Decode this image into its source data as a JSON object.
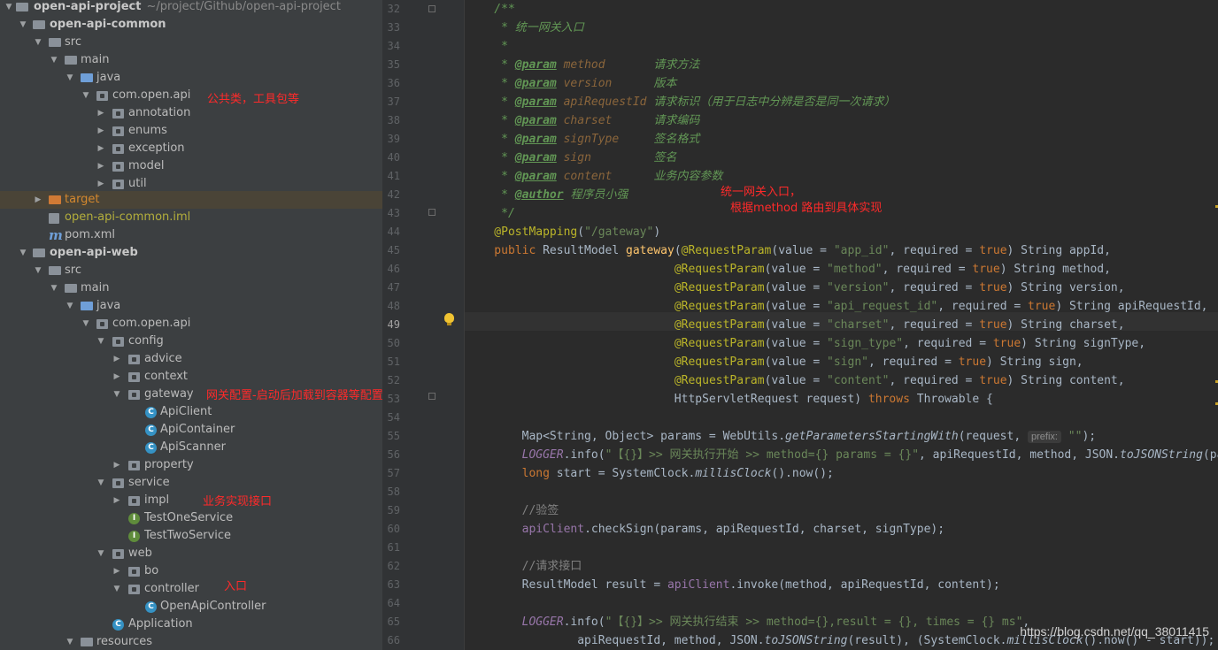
{
  "project_tree": {
    "project": {
      "name": "open-api-project",
      "path": "~/project/Github/open-api-project"
    },
    "rows": [
      {
        "label": "open-api-project"
      },
      {
        "label": "open-api-common"
      },
      {
        "label": "src"
      },
      {
        "label": "main"
      },
      {
        "label": "java"
      },
      {
        "label": "com.open.api"
      },
      {
        "label": "annotation"
      },
      {
        "label": "enums"
      },
      {
        "label": "exception"
      },
      {
        "label": "model"
      },
      {
        "label": "util"
      },
      {
        "label": "target"
      },
      {
        "label": "open-api-common.iml"
      },
      {
        "label": "pom.xml"
      },
      {
        "label": "open-api-web"
      },
      {
        "label": "src"
      },
      {
        "label": "main"
      },
      {
        "label": "java"
      },
      {
        "label": "com.open.api"
      },
      {
        "label": "config"
      },
      {
        "label": "advice"
      },
      {
        "label": "context"
      },
      {
        "label": "gateway"
      },
      {
        "label": "ApiClient"
      },
      {
        "label": "ApiContainer"
      },
      {
        "label": "ApiScanner"
      },
      {
        "label": "property"
      },
      {
        "label": "service"
      },
      {
        "label": "impl"
      },
      {
        "label": "TestOneService"
      },
      {
        "label": "TestTwoService"
      },
      {
        "label": "web"
      },
      {
        "label": "bo"
      },
      {
        "label": "controller"
      },
      {
        "label": "OpenApiController"
      },
      {
        "label": "Application"
      },
      {
        "label": "resources"
      }
    ],
    "icon_chars": {
      "class": "C",
      "interface": "I",
      "maven": "m"
    }
  },
  "annotations": {
    "common_pkg": "公共类，工具包等",
    "gateway": "网关配置-启动后加载到容器等配置",
    "service": "业务实现接口",
    "controller": "入口",
    "editor_line1": "统一网关入口，",
    "editor_line2": "根据method 路由到具体实现"
  },
  "editor": {
    "current_line": 49,
    "hint": "prefix:",
    "lines": [
      {
        "n": 32,
        "t": "/**"
      },
      {
        "n": 33,
        "t": " * 统一网关入口"
      },
      {
        "n": 34,
        "t": " *"
      },
      {
        "n": 35,
        "t": " * @param method       请求方法"
      },
      {
        "n": 36,
        "t": " * @param version      版本"
      },
      {
        "n": 37,
        "t": " * @param apiRequestId 请求标识（用于日志中分辨是否是同一次请求）"
      },
      {
        "n": 38,
        "t": " * @param charset      请求编码"
      },
      {
        "n": 39,
        "t": " * @param signType     签名格式"
      },
      {
        "n": 40,
        "t": " * @param sign         签名"
      },
      {
        "n": 41,
        "t": " * @param content      业务内容参数"
      },
      {
        "n": 42,
        "t": " * @author 程序员小强"
      },
      {
        "n": 43,
        "t": " */"
      },
      {
        "n": 44,
        "t": "@PostMapping(\"/gateway\")"
      },
      {
        "n": 45,
        "t": "public ResultModel gateway(@RequestParam(value = \"app_id\", required = true) String appId,"
      },
      {
        "n": 46,
        "t": "@RequestParam(value = \"method\", required = true) String method,"
      },
      {
        "n": 47,
        "t": "@RequestParam(value = \"version\", required = true) String version,"
      },
      {
        "n": 48,
        "t": "@RequestParam(value = \"api_request_id\", required = true) String apiRequestId,"
      },
      {
        "n": 49,
        "t": "@RequestParam(value = \"charset\", required = true) String charset,"
      },
      {
        "n": 50,
        "t": "@RequestParam(value = \"sign_type\", required = true) String signType,"
      },
      {
        "n": 51,
        "t": "@RequestParam(value = \"sign\", required = true) String sign,"
      },
      {
        "n": 52,
        "t": "@RequestParam(value = \"content\", required = true) String content,"
      },
      {
        "n": 53,
        "t": "HttpServletRequest request) throws Throwable {"
      },
      {
        "n": 54,
        "t": ""
      },
      {
        "n": 55,
        "t": "Map<String, Object> params = WebUtils.getParametersStartingWith(request, \"\");"
      },
      {
        "n": 56,
        "t": "LOGGER.info(\"【{}】>> 网关执行开始 >> method={} params = {}\", apiRequestId, method, JSON.toJSONString(para"
      },
      {
        "n": 57,
        "t": "long start = SystemClock.millisClock().now();"
      },
      {
        "n": 58,
        "t": ""
      },
      {
        "n": 59,
        "t": "//验签"
      },
      {
        "n": 60,
        "t": "apiClient.checkSign(params, apiRequestId, charset, signType);"
      },
      {
        "n": 61,
        "t": ""
      },
      {
        "n": 62,
        "t": "//请求接口"
      },
      {
        "n": 63,
        "t": "ResultModel result = apiClient.invoke(method, apiRequestId, content);"
      },
      {
        "n": 64,
        "t": ""
      },
      {
        "n": 65,
        "t": "LOGGER.info(\"【{}】>> 网关执行结束 >> method={},result = {}, times = {} ms\","
      },
      {
        "n": 66,
        "t": "apiRequestId, method, JSON.toJSONString(result), (SystemClock.millisClock().now() - start));"
      }
    ]
  },
  "watermark": "https://blog.csdn.net/qq_38011415",
  "colors": {
    "sidebar_bg": "#3c3f41",
    "editor_bg": "#2b2b2b",
    "keyword": "#cc7832",
    "string": "#6a8759",
    "annotation": "#bbb529",
    "doc": "#629755",
    "annotation_red": "#ff2a2a"
  }
}
